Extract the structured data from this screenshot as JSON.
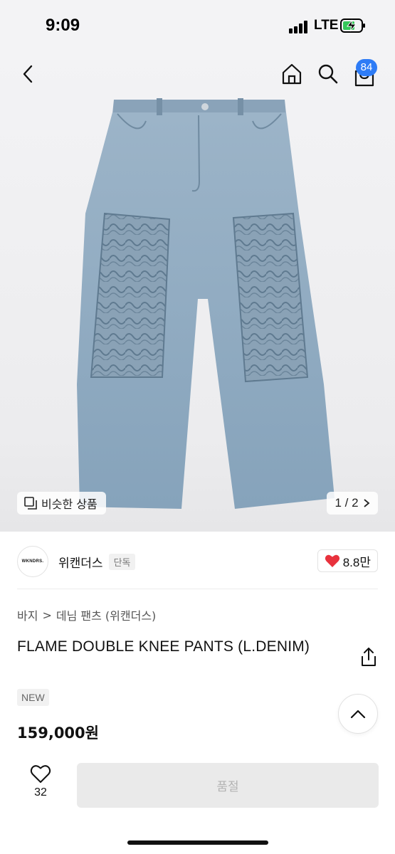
{
  "status_bar": {
    "time": "9:09",
    "network": "LTE"
  },
  "header": {
    "cart_count": "84"
  },
  "gallery": {
    "similar_label": "비슷한 상품",
    "pager": "1 / 2"
  },
  "brand": {
    "logo_text": "WKNDRS.",
    "name": "위캔더스",
    "tag": "단독",
    "likes": "8.8만"
  },
  "breadcrumb": {
    "level1": "바지",
    "separator": ">",
    "level2": "데님 팬츠 (위캔더스)"
  },
  "product": {
    "title": "FLAME DOUBLE KNEE PANTS (L.DENIM)",
    "badge": "NEW",
    "price": "159,000원"
  },
  "bottom": {
    "wish_count": "32",
    "buy_label": "품절"
  },
  "colors": {
    "accent": "#2e7cf6",
    "heart": "#e8323d",
    "denim": "#8fa9bf"
  }
}
